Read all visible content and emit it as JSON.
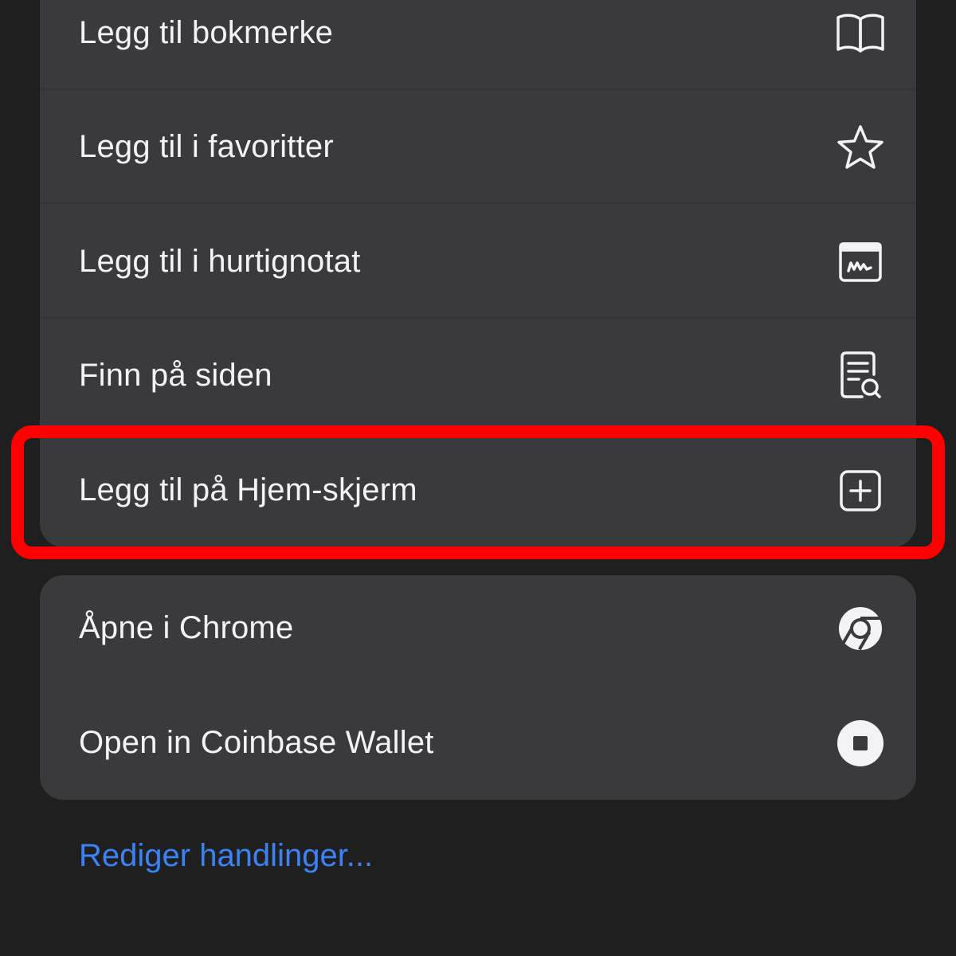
{
  "menu": {
    "items": [
      {
        "label": "Legg til bokmerke",
        "icon": "book-icon"
      },
      {
        "label": "Legg til i favoritter",
        "icon": "star-icon"
      },
      {
        "label": "Legg til i hurtignotat",
        "icon": "quick-note-icon"
      },
      {
        "label": "Finn på siden",
        "icon": "find-on-page-icon"
      },
      {
        "label": "Legg til på Hjem-skjerm",
        "icon": "add-square-icon"
      }
    ],
    "extensions": [
      {
        "label": "Åpne i Chrome",
        "icon": "chrome-icon"
      },
      {
        "label": "Open in Coinbase Wallet",
        "icon": "coinbase-icon"
      }
    ],
    "edit_actions": "Rediger handlinger..."
  },
  "colors": {
    "background": "#1f1f1f",
    "group": "#3a3a3c",
    "text": "#f2f2f7",
    "link": "#3b82f6",
    "highlight": "#ff0000"
  }
}
